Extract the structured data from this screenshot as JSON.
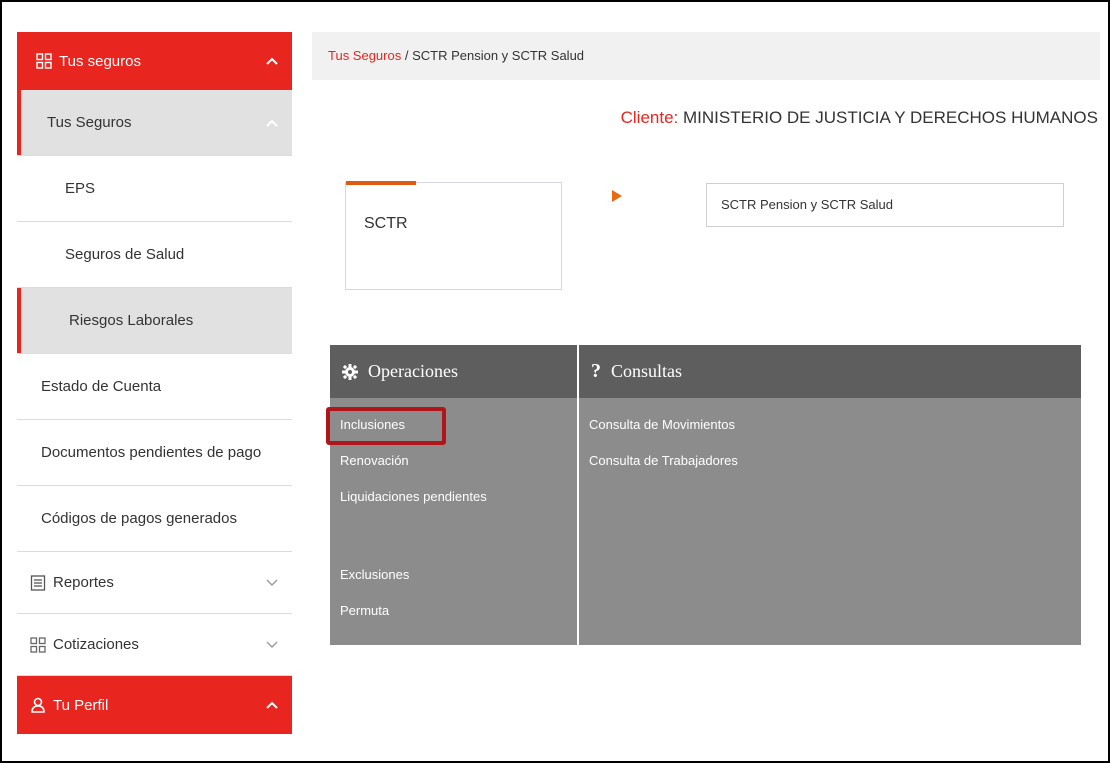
{
  "sidebar": {
    "section_insurance": "Tus seguros",
    "items": [
      {
        "label": "Tus Seguros"
      },
      {
        "label": "EPS"
      },
      {
        "label": "Seguros de Salud"
      },
      {
        "label": "Riesgos Laborales"
      },
      {
        "label": "Estado de Cuenta"
      },
      {
        "label": "Documentos pendientes de pago"
      },
      {
        "label": "Códigos de pagos generados"
      },
      {
        "label": "Reportes"
      },
      {
        "label": "Cotizaciones"
      }
    ],
    "section_profile": "Tu Perfil"
  },
  "breadcrumb": {
    "link": "Tus Seguros",
    "separator": " / ",
    "current": "SCTR Pension y SCTR Salud"
  },
  "client": {
    "label": "Cliente:",
    "value": "MINISTERIO DE JUSTICIA Y DERECHOS HUMANOS"
  },
  "product_card": {
    "label": "SCTR"
  },
  "product_select": {
    "value": "SCTR Pension y SCTR Salud"
  },
  "operations": {
    "title": "Operaciones",
    "items": [
      "Inclusiones",
      "Renovación",
      "Liquidaciones pendientes",
      "Exclusiones",
      "Permuta"
    ]
  },
  "queries": {
    "title": "Consultas",
    "items": [
      "Consulta de Movimientos",
      "Consulta de Trabajadores"
    ]
  },
  "colors": {
    "accent_red": "#e8251f",
    "header_dark": "#5e5e5e",
    "panel_grey": "#8c8c8c",
    "highlight_box": "#b01519"
  }
}
